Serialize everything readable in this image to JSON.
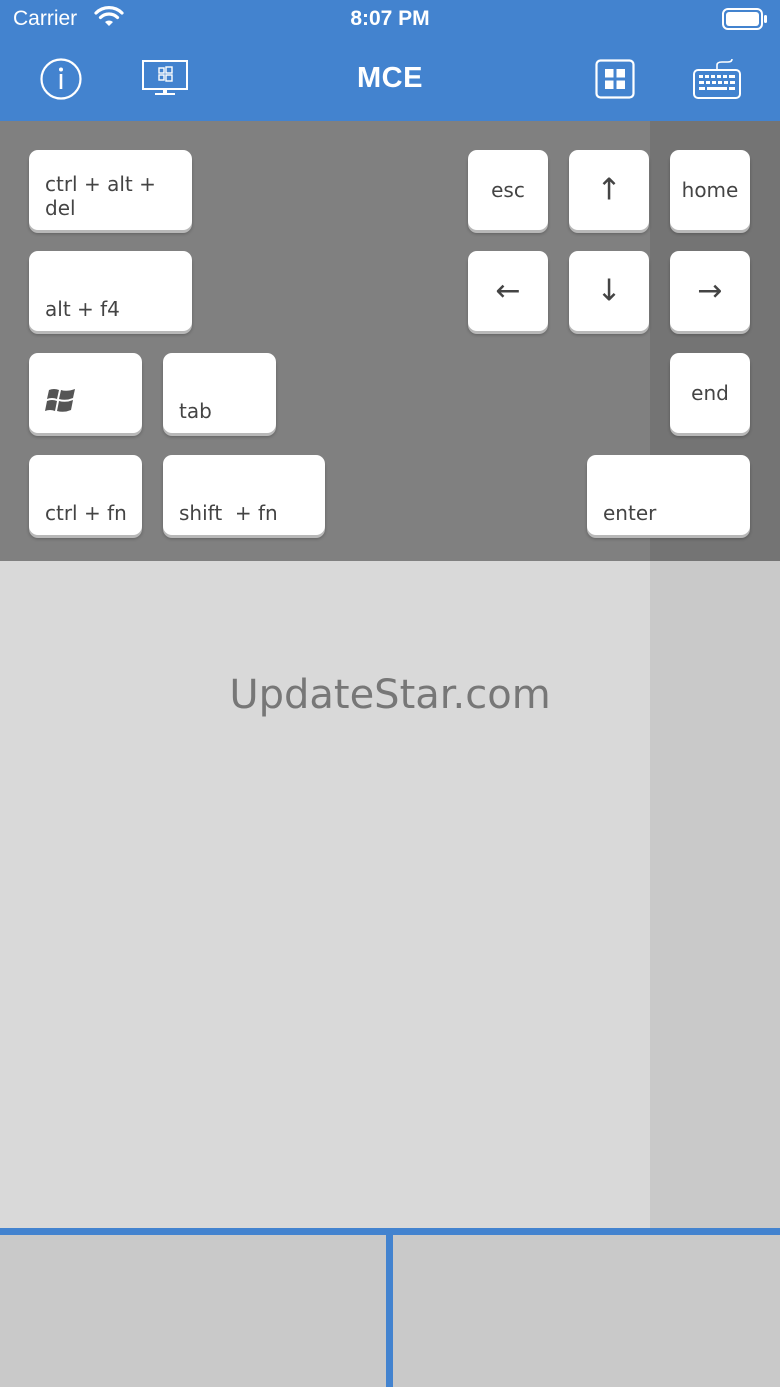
{
  "status": {
    "carrier": "Carrier",
    "time": "8:07 PM"
  },
  "nav": {
    "title": "MCE",
    "info_icon": "info-icon",
    "monitor_icon": "monitor-icon",
    "windows_icon": "windows-grid-icon",
    "keyboard_icon": "keyboard-icon"
  },
  "keys": {
    "ctrl_alt_del": "ctrl + alt + del",
    "alt_f4": "alt + f4",
    "tab": "tab",
    "ctrl_fn": "ctrl + fn",
    "shift_fn": "shift  + fn",
    "esc": "esc",
    "up": "↑",
    "home": "home",
    "left": "←",
    "down": "↓",
    "right": "→",
    "end": "end",
    "enter": "enter"
  },
  "watermark": "UpdateStar.com",
  "colors": {
    "accent": "#4383cf",
    "panel": "#808080",
    "touchpad": "#d9d9d9"
  }
}
